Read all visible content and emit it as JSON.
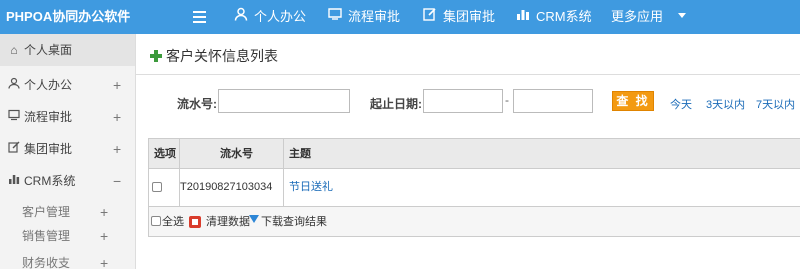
{
  "app": {
    "title": "PHPOA协同办公软件"
  },
  "topnav": {
    "items": [
      {
        "label": "个人办公",
        "icon": "user-icon"
      },
      {
        "label": "流程审批",
        "icon": "workflow-icon"
      },
      {
        "label": "集团审批",
        "icon": "edit-icon"
      },
      {
        "label": "CRM系统",
        "icon": "bar-chart-icon"
      },
      {
        "label": "更多应用",
        "icon": "chevron-down-icon"
      }
    ]
  },
  "sidebar": {
    "items": [
      {
        "label": "个人桌面",
        "icon": "home-icon",
        "toggle": ""
      },
      {
        "label": "个人办公",
        "icon": "user-icon",
        "toggle": "+"
      },
      {
        "label": "流程审批",
        "icon": "workflow-icon",
        "toggle": "+"
      },
      {
        "label": "集团审批",
        "icon": "edit-icon",
        "toggle": "+"
      },
      {
        "label": "CRM系统",
        "icon": "bar-chart-icon",
        "toggle": "−"
      }
    ],
    "subitems": [
      {
        "label": "客户管理",
        "toggle": "+"
      },
      {
        "label": "销售管理",
        "toggle": "+"
      },
      {
        "label": "财务收支",
        "toggle": "+"
      }
    ]
  },
  "main": {
    "title": "客户关怀信息列表",
    "search": {
      "serial_label": "流水号:",
      "serial_value": "",
      "date_label": "起止日期:",
      "date_from": "",
      "date_to": "",
      "date_sep": "-",
      "button_label": "查 找",
      "quick_links": [
        "今天",
        "3天以内",
        "7天以内"
      ]
    },
    "table": {
      "columns": [
        "选项",
        "流水号",
        "主题"
      ],
      "rows": [
        {
          "serial": "T20190827103034",
          "subject": "节日送礼"
        }
      ]
    },
    "footer": {
      "select_all": "全选",
      "clear_data": "清理数据",
      "download": "下载查询结果"
    }
  },
  "colors": {
    "topbar": "#3f9ae0",
    "search_button": "#f39a12",
    "link": "#1a6bb8"
  }
}
